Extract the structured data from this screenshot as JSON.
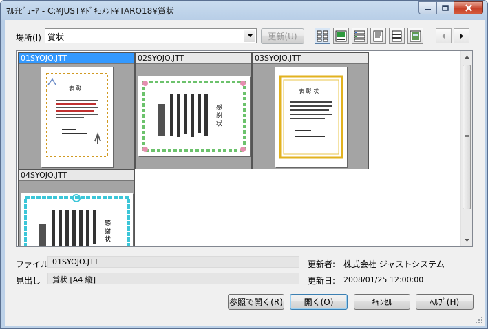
{
  "window": {
    "title": "ﾏﾙﾁﾋﾞｭｰｱ - C:¥JUST¥ﾄﾞｷｭﾒﾝﾄ¥TARO18¥賞状"
  },
  "toolbar": {
    "location_label": "場所(I)",
    "location_value": "賞状",
    "refresh_label": "更新(U)",
    "view_modes": [
      "thumbnail-grid-icon",
      "thumbnail-caption-icon",
      "detail-list-icon",
      "document-icon",
      "document-lines-icon",
      "image-preview-icon"
    ],
    "nav": [
      "prev-arrow-icon",
      "next-arrow-icon"
    ]
  },
  "thumbnails": [
    {
      "name": "01SYOJO.JTT",
      "selected": true,
      "heading": "表 彰"
    },
    {
      "name": "02SYOJO.JTT",
      "selected": false,
      "heading": "感 謝 状"
    },
    {
      "name": "03SYOJO.JTT",
      "selected": false,
      "heading": "表 彰 状"
    },
    {
      "name": "04SYOJO.JTT",
      "selected": false,
      "heading": "感 謝 状"
    }
  ],
  "info": {
    "filename_label": "ファイル名",
    "filename_value": "01SYOJO.JTT",
    "heading_label": "見出し",
    "heading_value": "賞状 [A4 縦]",
    "updater_label": "更新者:",
    "updater_value": "株式会社 ジャストシステム",
    "updated_label": "更新日:",
    "updated_value": "2008/01/25 12:00:00"
  },
  "buttons": {
    "open_ref": "参照で開く(R)",
    "open": "開く(O)",
    "cancel": "ｷｬﾝｾﾙ",
    "help": "ﾍﾙﾌﾟ(H)"
  }
}
